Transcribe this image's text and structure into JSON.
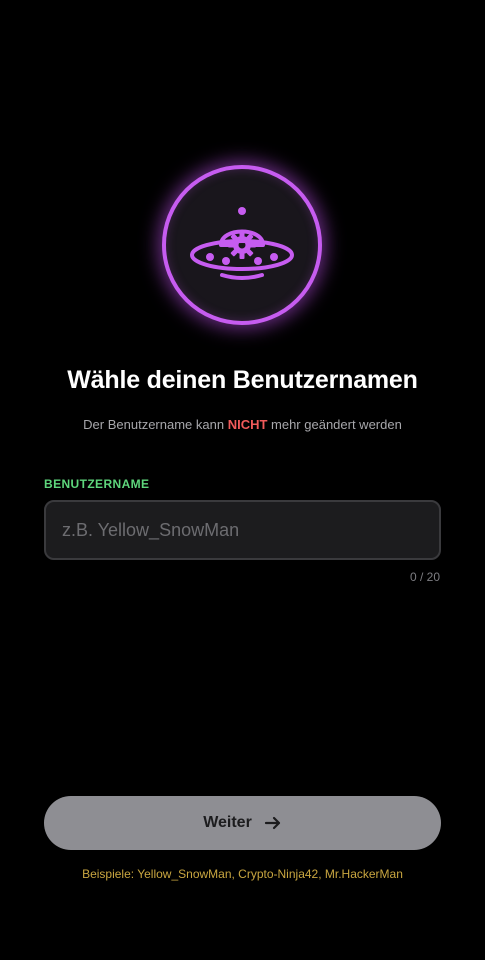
{
  "header": {
    "emblem_icon": "ufo-gear-icon",
    "title": "Wähle deinen Benutzernamen",
    "subtitle_prefix": "Der Benutzername kann ",
    "subtitle_emphasis": "NICHT",
    "subtitle_suffix": " mehr geändert werden"
  },
  "form": {
    "label": "BENUTZERNAME",
    "value": "",
    "placeholder": "z.B. Yellow_SnowMan",
    "counter": "0 / 20"
  },
  "footer": {
    "continue_label": "Weiter",
    "continue_icon": "arrow-right-icon",
    "examples": "Beispiele: Yellow_SnowMan, Crypto-Ninja42, Mr.HackerMan"
  },
  "colors": {
    "background": "#000000",
    "accent_purple": "#c65cf0",
    "label_green": "#5ed67c",
    "warning_red": "#f05a5a",
    "examples_gold": "#c9a640",
    "button_disabled": "#8e8e93"
  }
}
